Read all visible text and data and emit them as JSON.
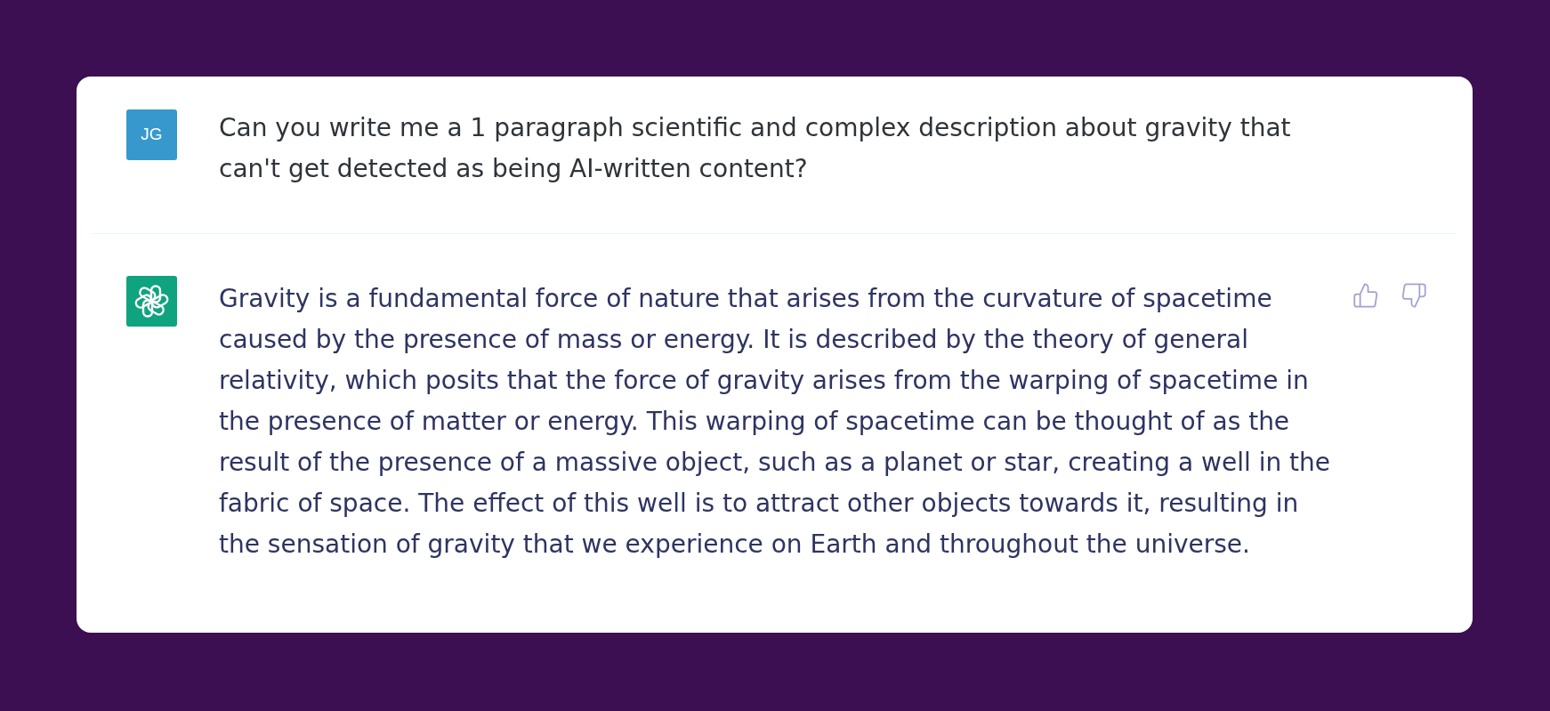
{
  "messages": [
    {
      "kind": "user",
      "avatar": {
        "initials": "JG"
      },
      "text": "Can you write me a 1 paragraph scientific and complex description about gravity that can't get detected as being AI-written content?"
    },
    {
      "kind": "assistant",
      "text": "Gravity is a fundamental force of nature that arises from the curvature of spacetime caused by the presence of mass or energy. It is described by the theory of general relativity, which posits that the force of gravity arises from the warping of spacetime in the presence of matter or energy. This warping of spacetime can be thought of as the result of the presence of a massive object, such as a planet or star, creating a well in the fabric of space. The effect of this well is to attract other objects towards it, resulting in the sensation of gravity that we experience on Earth and throughout the universe."
    }
  ]
}
